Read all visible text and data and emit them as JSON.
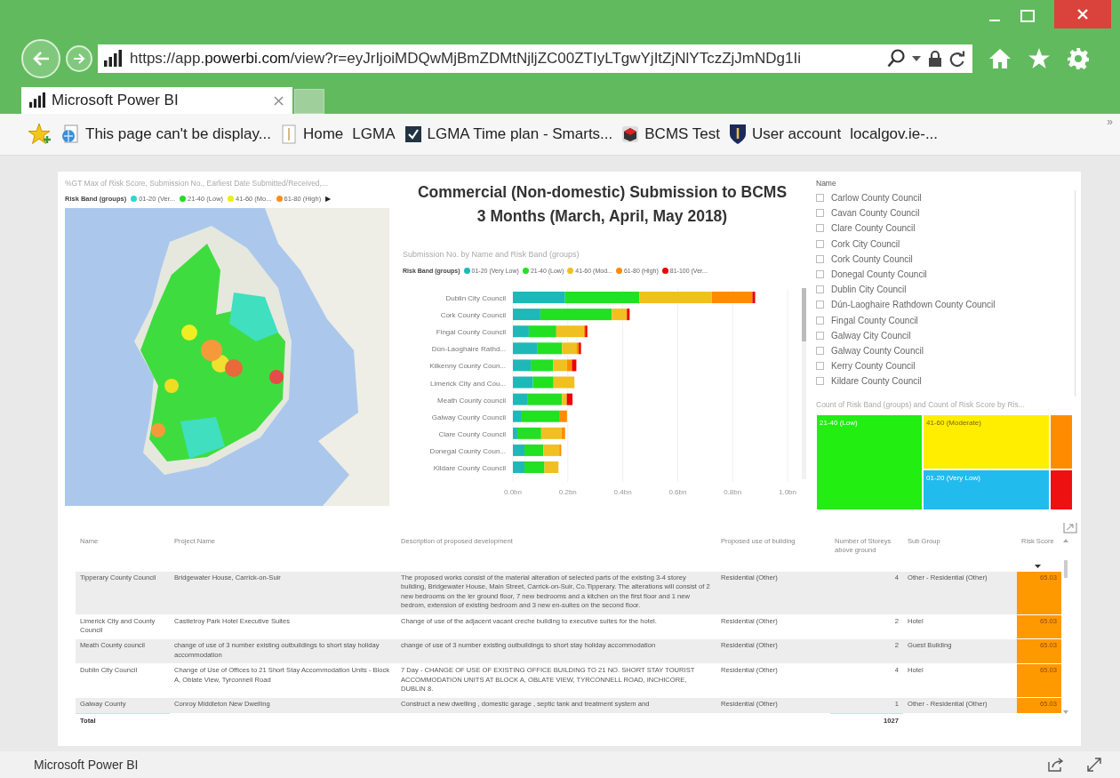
{
  "browser": {
    "url": {
      "start": "https://app.",
      "domain": "powerbi.com",
      "rest": "/view?r=eyJrIjoiMDQwMjBmZDMtNjljZC00ZTIyLTgwYjItZjNlYTczZjJmNDg1Ii"
    },
    "tabs": [
      {
        "title": "Microsoft Power BI",
        "selected": true
      }
    ],
    "favorites": [
      {
        "label": "This page can't be display...",
        "kind": "globe"
      },
      {
        "label": "Home",
        "kind": "page"
      },
      {
        "label": "LGMA",
        "kind": "none"
      },
      {
        "label": "LGMA Time plan - Smarts...",
        "kind": "check"
      },
      {
        "label": "BCMS Test",
        "kind": "cube"
      },
      {
        "label": "User account",
        "kind": "shield"
      },
      {
        "label": "localgov.ie-...",
        "kind": "none"
      }
    ],
    "favorites_more": "»"
  },
  "map": {
    "title": "%GT Max of Risk Score, Submission No., Earliest Date Submitted/Received,...",
    "legend_title": "Risk Band (groups)",
    "legend": [
      {
        "label": "01-20 (Ver...",
        "color": "#2fd8cc"
      },
      {
        "label": "21-40 (Low)",
        "color": "#22dd22"
      },
      {
        "label": "41-60 (Mo...",
        "color": "#eeee00"
      },
      {
        "label": "61-80 (High)",
        "color": "#ff8c1a"
      }
    ],
    "legend_more": "▶"
  },
  "chart": {
    "heading": [
      "Commercial (Non-domestic) Submission to BCMS",
      "3 Months (March, April, May 2018)"
    ],
    "legend_title": "Risk Band (groups)",
    "chart_data": {
      "type": "bar",
      "orientation": "horizontal",
      "stacked": true,
      "title": "Submission No. by Name and Risk Band (groups)",
      "categories": [
        "Dublin City Council",
        "Cork County Council",
        "Fingal County Council",
        "Dún-Laoghaire Rathd...",
        "Kilkenny County Coun...",
        "Limerick City and Cou...",
        "Meath County council",
        "Galway County Council",
        "Clare County Council",
        "Donegal County Coun...",
        "Kildare County Council"
      ],
      "series": [
        {
          "name": "01-20 (Very Low)",
          "color": "#1fb8b8",
          "values": [
            0.19,
            0.1,
            0.058,
            0.09,
            0.065,
            0.073,
            0.052,
            0.032,
            0.016,
            0.042,
            0.042
          ]
        },
        {
          "name": "21-40 (Low)",
          "color": "#22e022",
          "values": [
            0.27,
            0.26,
            0.1,
            0.089,
            0.082,
            0.075,
            0.127,
            0.139,
            0.087,
            0.069,
            0.073
          ]
        },
        {
          "name": "41-60 (Mod...",
          "color": "#f0c020",
          "values": [
            0.264,
            0.055,
            0.1,
            0.054,
            0.05,
            0.076,
            0.017,
            0,
            0.074,
            0.058,
            0.051
          ]
        },
        {
          "name": "61-80 (High)",
          "color": "#ff8c00",
          "values": [
            0.148,
            0,
            0.005,
            0.007,
            0.018,
            0,
            0,
            0.026,
            0.013,
            0.007,
            0
          ]
        },
        {
          "name": "81-100 (Ver...",
          "color": "#ee0000",
          "values": [
            0.01,
            0.01,
            0.008,
            0.008,
            0.016,
            0,
            0.021,
            0,
            0,
            0,
            0
          ]
        }
      ],
      "xlim": [
        0,
        1
      ],
      "grid": true,
      "xticks": [
        {
          "value": 0,
          "label": "0.0bn"
        },
        {
          "value": 0.2,
          "label": "0.2bn"
        },
        {
          "value": 0.4,
          "label": "0.4bn"
        },
        {
          "value": 0.6,
          "label": "0.6bn"
        },
        {
          "value": 0.8,
          "label": "0.8bn"
        },
        {
          "value": 1,
          "label": "1.0bn"
        }
      ]
    }
  },
  "slicer": {
    "title": "Name",
    "items": [
      {
        "label": "Carlow County Council",
        "checked": false
      },
      {
        "label": "Cavan County Council",
        "checked": false
      },
      {
        "label": "Clare County Council",
        "checked": false
      },
      {
        "label": "Cork City Council",
        "checked": false
      },
      {
        "label": "Cork County Council",
        "checked": false
      },
      {
        "label": "Donegal County Council",
        "checked": false
      },
      {
        "label": "Dublin City Council",
        "checked": false
      },
      {
        "label": "Dún-Laoghaire Rathdown County Council",
        "checked": false
      },
      {
        "label": "Fingal County Council",
        "checked": false
      },
      {
        "label": "Galway City Council",
        "checked": false
      },
      {
        "label": "Galway County Council",
        "checked": false
      },
      {
        "label": "Kerry County Council",
        "checked": false
      },
      {
        "label": "Kildare County Council",
        "checked": false
      }
    ]
  },
  "treemap": {
    "title": "Count of Risk Band (groups) and Count of Risk Score by Ris...",
    "tiles": [
      {
        "label": "21-40 (Low)",
        "color": "#22ee11"
      },
      {
        "label": "41-60 (Moderate)",
        "color": "#ffee00"
      },
      {
        "label": "01-20 (Very Low)",
        "color": "#22bbee"
      },
      {
        "color": "#ff8c00"
      },
      {
        "color": "#ee1111"
      }
    ]
  },
  "table": {
    "columns": [
      "Name",
      "Project Name",
      "Description of proposed development",
      "Proposed use of building",
      "Number of Storeys above ground",
      "Sub Group",
      "Risk Score"
    ],
    "rows": [
      {
        "cells": [
          "Tipperary County Council",
          "Bridgewater House, Carrick-on-Suir",
          "The proposed works consist of the material alteration of selected parts of the existing 3-4 storey building, Bridgewater House, Main Street, Carrick-on-Suir, Co.Tipperary. The alterations will consist of 2 new bedrooms on the ler ground floor, 7 new bedrooms and a kitchen on the first floor and 1 new bedrom, extension of existing bedroom and 3 new en-suites on the second floor.",
          "Residential (Other)",
          "4",
          "Other - Residential (Other)",
          "65.03"
        ]
      },
      {
        "cells": [
          "Limerick City and County Council",
          "Castletroy Park Hotel Executive Suites",
          "Change of use of the adjacent vacant creche building to executive suites for the hotel.",
          "Residential (Other)",
          "2",
          "Hotel",
          "65.03"
        ]
      },
      {
        "cells": [
          "Meath County council",
          "change of use of 3 number existing outbuildings to short stay holiday accommodation",
          "change of use of 3 number existing outbuildings to short stay holiday accommodation",
          "Residential (Other)",
          "2",
          "Guest Building",
          "65.03"
        ]
      },
      {
        "cells": [
          "Dublin City Council",
          "Change of Use of Offices to 21 Short Stay Accommodation Units - Block A, Oblate View, Tyrconnell Road",
          "7 Day - CHANGE OF USE OF EXISTING OFFICE BUILDING TO 21 NO. SHORT STAY TOURIST ACCOMMODATION UNITS AT BLOCK A, OBLATE VIEW, TYRCONNELL ROAD, INCHICORE, DUBLIN 8.",
          "Residential (Other)",
          "4",
          "Hotel",
          "65.03"
        ]
      },
      {
        "cells": [
          "Galway County",
          "Conroy Middleton New Dwelling",
          "Construct a new dwelling , domestic garage , septic tank and treatment system and",
          "Residential (Other)",
          "1",
          "Other - Residential (Other)",
          "65.03"
        ]
      }
    ],
    "total": {
      "label": "Total",
      "value": "1027"
    }
  },
  "footer": {
    "title": "Microsoft Power BI"
  }
}
